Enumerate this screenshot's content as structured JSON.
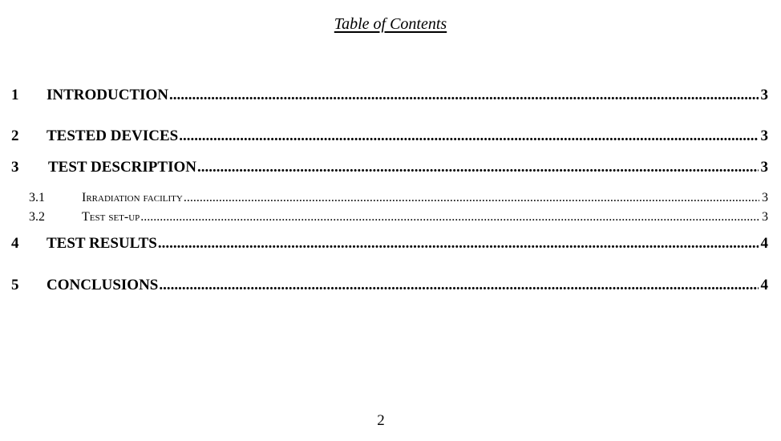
{
  "toc": {
    "title": "Table of Contents",
    "entries": [
      {
        "num": "1",
        "label": "INTRODUCTION",
        "page": "3"
      },
      {
        "num": "2",
        "label": "TESTED DEVICES",
        "page": "3"
      },
      {
        "num": "3",
        "label": "TEST DESCRIPTION",
        "page": "3"
      },
      {
        "num": "3.1",
        "label": "Irradiation facility",
        "page": "3"
      },
      {
        "num": "3.2",
        "label": "Test set-up",
        "page": "3"
      },
      {
        "num": "4",
        "label": "TEST RESULTS",
        "page": "4"
      },
      {
        "num": "5",
        "label": "CONCLUSIONS",
        "page": "4"
      }
    ]
  },
  "footer": {
    "page_number": "2"
  }
}
